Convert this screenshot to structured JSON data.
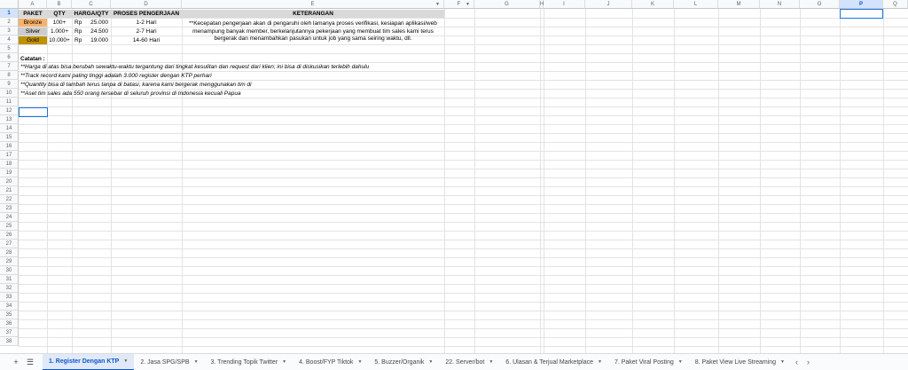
{
  "sheet": {
    "columns": [
      "A",
      "B",
      "C",
      "D",
      "E",
      "F",
      "G",
      "H",
      "I",
      "J",
      "K",
      "L",
      "M",
      "N",
      "O",
      "P",
      "Q"
    ],
    "selected_column": "P",
    "rows_visible": 38,
    "selected_row": "1"
  },
  "table": {
    "headers": {
      "paket": "PAKET",
      "qty": "QTY",
      "harga": "HARGA/QTY",
      "proses": "PROSES PENGERJAAN",
      "keterangan": "KETERANGAN"
    },
    "rows": [
      {
        "paket": "Bronze",
        "qty": "100+",
        "currency": "Rp",
        "price": "25.000",
        "proses": "1-2 Hari",
        "color": "#f6b26b"
      },
      {
        "paket": "Silver",
        "qty": "1.000+",
        "currency": "Rp",
        "price": "24.500",
        "proses": "2-7 Hari",
        "color": "#cccccc"
      },
      {
        "paket": "Gold",
        "qty": "10.000+",
        "currency": "Rp",
        "price": "19.000",
        "proses": "14-60 Hari",
        "color": "#bf9000"
      }
    ],
    "keterangan_text": "**Kecepatan pengerjaan akan di pengaruhi oleh lamanya proses verifikasi, kesiapan aplikasi/web menampung banyak member, berkelanjutannya pekerjaan yang membuat tim sales kami terus bergerak dan menambahkan pasukan untuk job yang sama seiring waktu, dll."
  },
  "notes": {
    "title": "Catatan :",
    "items": [
      "**Harga di atas bisa berubah sewaktu-waktu tergantung dari tingkat kesulitan dan request dari klien; ini bisa di diskusikan terlebih dahulu",
      "**Track record kami paling tinggi adalah 3.000 register dengan KTP perhari",
      "**Quantity bisa di tambah terus tanpa di batasi, karena kami bergerak menggunakan tim di",
      "**Aset tim sales ada 550 orang tersebar di seluruh provinsi di Indonesia kecuali Papua"
    ]
  },
  "tabs": [
    {
      "label": "1. Register Dengan KTP",
      "active": true
    },
    {
      "label": "2. Jasa SPG/SPB",
      "active": false
    },
    {
      "label": "3. Trending Topik Twitter",
      "active": false
    },
    {
      "label": "4. Boost/FYP Tiktok",
      "active": false
    },
    {
      "label": "5. Buzzer/Organik",
      "active": false
    },
    {
      "label": "22. Server/bot",
      "active": false
    },
    {
      "label": "6. Ulasan & Terjual Marketplace",
      "active": false
    },
    {
      "label": "7. Paket Viral Posting",
      "active": false
    },
    {
      "label": "8. Paket View Live Streaming",
      "active": false
    }
  ],
  "icons": {
    "all_sheets": "menu-icon",
    "prev": "chevron-left-icon",
    "next": "chevron-right-icon",
    "dropdown": "caret-down-icon"
  }
}
